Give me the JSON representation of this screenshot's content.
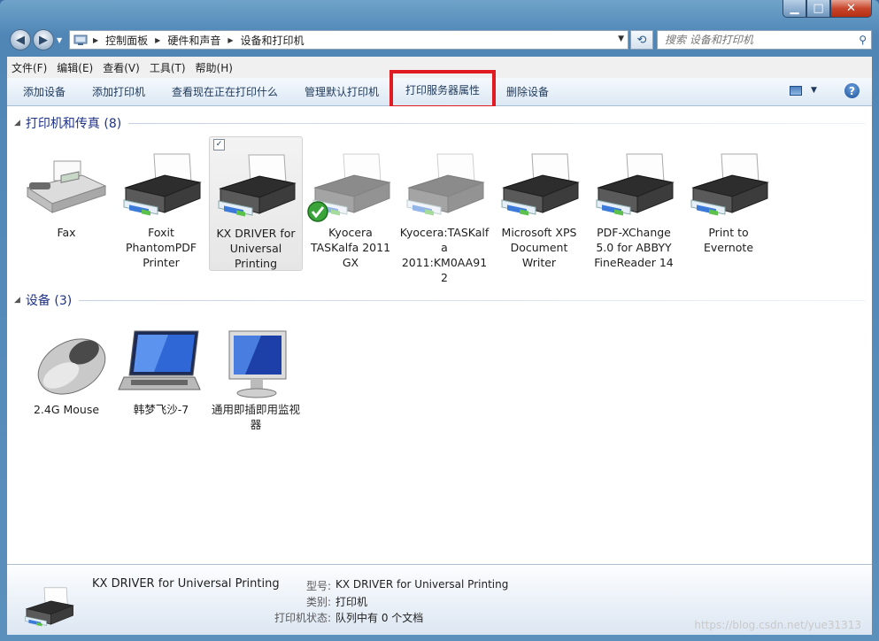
{
  "window": {
    "minimize": "▁",
    "maximize": "□",
    "close": "✕"
  },
  "nav": {
    "back": "◀",
    "forward": "▶",
    "dropdown": "▼",
    "refresh": "⟲"
  },
  "address": {
    "crumbs": [
      "控制面板",
      "硬件和声音",
      "设备和打印机"
    ],
    "separator": "▶"
  },
  "search": {
    "placeholder": "搜索 设备和打印机"
  },
  "menu": [
    "文件(F)",
    "编辑(E)",
    "查看(V)",
    "工具(T)",
    "帮助(H)"
  ],
  "commands": [
    "添加设备",
    "添加打印机",
    "查看现在正在打印什么",
    "管理默认打印机",
    "打印服务器属性",
    "删除设备"
  ],
  "groups": {
    "printers": {
      "title": "打印机和传真 (8)",
      "items": [
        {
          "label": "Fax"
        },
        {
          "label": "Foxit PhantomPDF Printer"
        },
        {
          "label": "KX DRIVER for Universal Printing"
        },
        {
          "label": "Kyocera TASKalfa 2011 GX"
        },
        {
          "label": "Kyocera:TASKalfa 2011:KM0AA912"
        },
        {
          "label": "Microsoft XPS Document Writer"
        },
        {
          "label": "PDF-XChange 5.0 for ABBYY FineReader 14"
        },
        {
          "label": "Print to Evernote"
        }
      ]
    },
    "devices": {
      "title": "设备 (3)",
      "items": [
        {
          "label": "2.4G Mouse"
        },
        {
          "label": "韩梦飞沙-7"
        },
        {
          "label": "通用即插即用监视器"
        }
      ]
    }
  },
  "status": {
    "name": "KX DRIVER for Universal Printing",
    "model_key": "型号:",
    "model_val": "KX DRIVER for Universal Printing",
    "type_key": "类别:",
    "type_val": "打印机",
    "state_key": "打印机状态:",
    "state_val": "队列中有 0 个文档"
  },
  "watermark": "https://blog.csdn.net/yue31313",
  "colors": {
    "highlight": "#e11b22",
    "group_title": "#1e3287",
    "frame": "#4f86b6"
  }
}
